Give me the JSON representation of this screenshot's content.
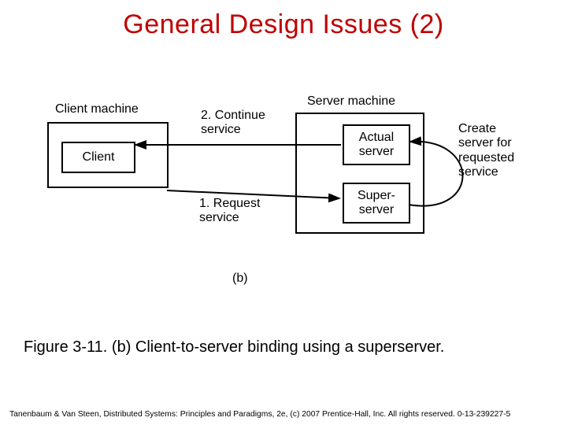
{
  "title": "General Design Issues (2)",
  "diagram": {
    "client_machine_label": "Client machine",
    "server_machine_label": "Server machine",
    "client_box": "Client",
    "actual_server_box": "Actual\nserver",
    "super_server_box": "Super-\nserver",
    "arrow_top": "2. Continue\nservice",
    "arrow_bottom": "1. Request\nservice",
    "side_note": "Create\nserver for\nrequested\nservice",
    "sub_label": "(b)"
  },
  "caption": "Figure 3-11. (b) Client-to-server binding using a superserver.",
  "footer": "Tanenbaum & Van Steen, Distributed Systems: Principles and Paradigms, 2e, (c) 2007 Prentice-Hall, Inc. All rights reserved. 0-13-239227-5"
}
